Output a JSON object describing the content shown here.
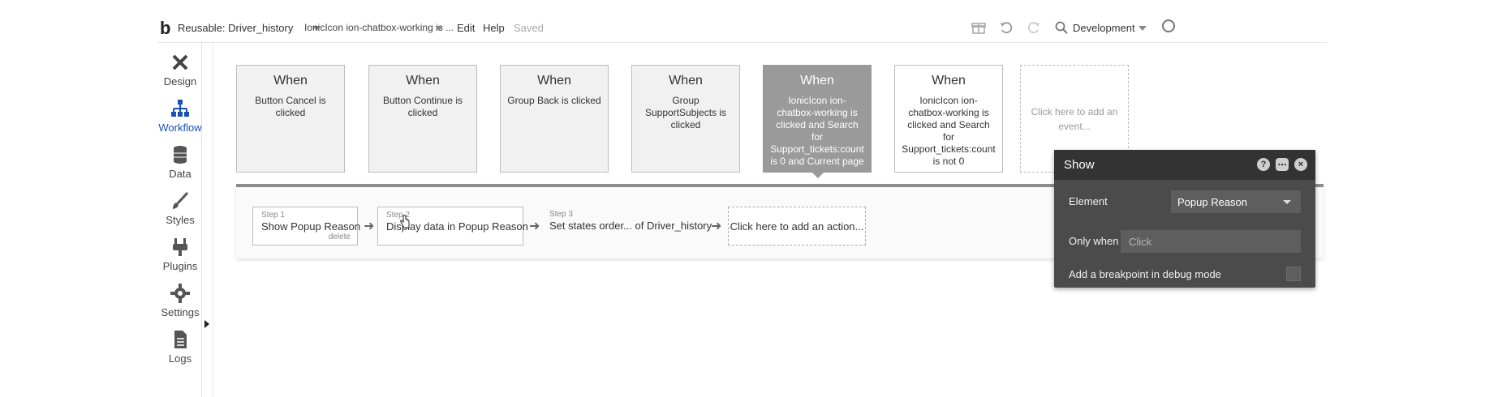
{
  "topbar": {
    "logo": "b",
    "page_selector": "Reusable: Driver_history",
    "element_selector": "IonicIcon ion-chatbox-working is ...",
    "menu": {
      "edit": "Edit",
      "help": "Help"
    },
    "status": "Saved",
    "environment": "Development",
    "icons": [
      "gift-icon",
      "undo-icon",
      "redo-icon",
      "search-icon",
      "user-icon"
    ]
  },
  "sidebar": {
    "items": [
      {
        "label": "Design",
        "icon": "design-icon"
      },
      {
        "label": "Workflow",
        "icon": "workflow-icon",
        "active": true
      },
      {
        "label": "Data",
        "icon": "database-icon"
      },
      {
        "label": "Styles",
        "icon": "brush-icon"
      },
      {
        "label": "Plugins",
        "icon": "plug-icon"
      },
      {
        "label": "Settings",
        "icon": "gear-icon"
      },
      {
        "label": "Logs",
        "icon": "document-icon"
      }
    ],
    "active_color": "#1a4fb4"
  },
  "events": [
    {
      "when": "When",
      "desc": "Button Cancel is clicked"
    },
    {
      "when": "When",
      "desc": "Button Continue is clicked"
    },
    {
      "when": "When",
      "desc": "Group Back is clicked"
    },
    {
      "when": "When",
      "desc": "Group SupportSubjects is clicked"
    },
    {
      "when": "When",
      "desc": "IonicIcon ion-chatbox-working is clicked and Search for Support_tickets:count is 0 and Current page",
      "selected": true
    },
    {
      "when": "When",
      "desc": "IonicIcon ion-chatbox-working is clicked and Search for Support_tickets:count is not 0"
    }
  ],
  "add_event": "Click here to add an event...",
  "actions": {
    "steps": [
      {
        "num": "Step 1",
        "name": "Show Popup Reason",
        "delete": "delete"
      },
      {
        "num": "Step 2",
        "name": "Display data in Popup Reason"
      },
      {
        "num": "Step 3",
        "name": "Set states order... of Driver_history"
      }
    ],
    "add_action": "Click here to add an action..."
  },
  "property_editor": {
    "title": "Show",
    "element_label": "Element",
    "element_value": "Popup Reason",
    "only_when_label": "Only when",
    "only_when_placeholder": "Click",
    "breakpoint_label": "Add a breakpoint in debug mode",
    "icons": [
      "help-icon",
      "comment-icon",
      "close-icon"
    ]
  },
  "colors": {
    "selected_event": "#9a9a9a",
    "panel_dark": "#4b4b4b",
    "panel_header": "#333333"
  }
}
